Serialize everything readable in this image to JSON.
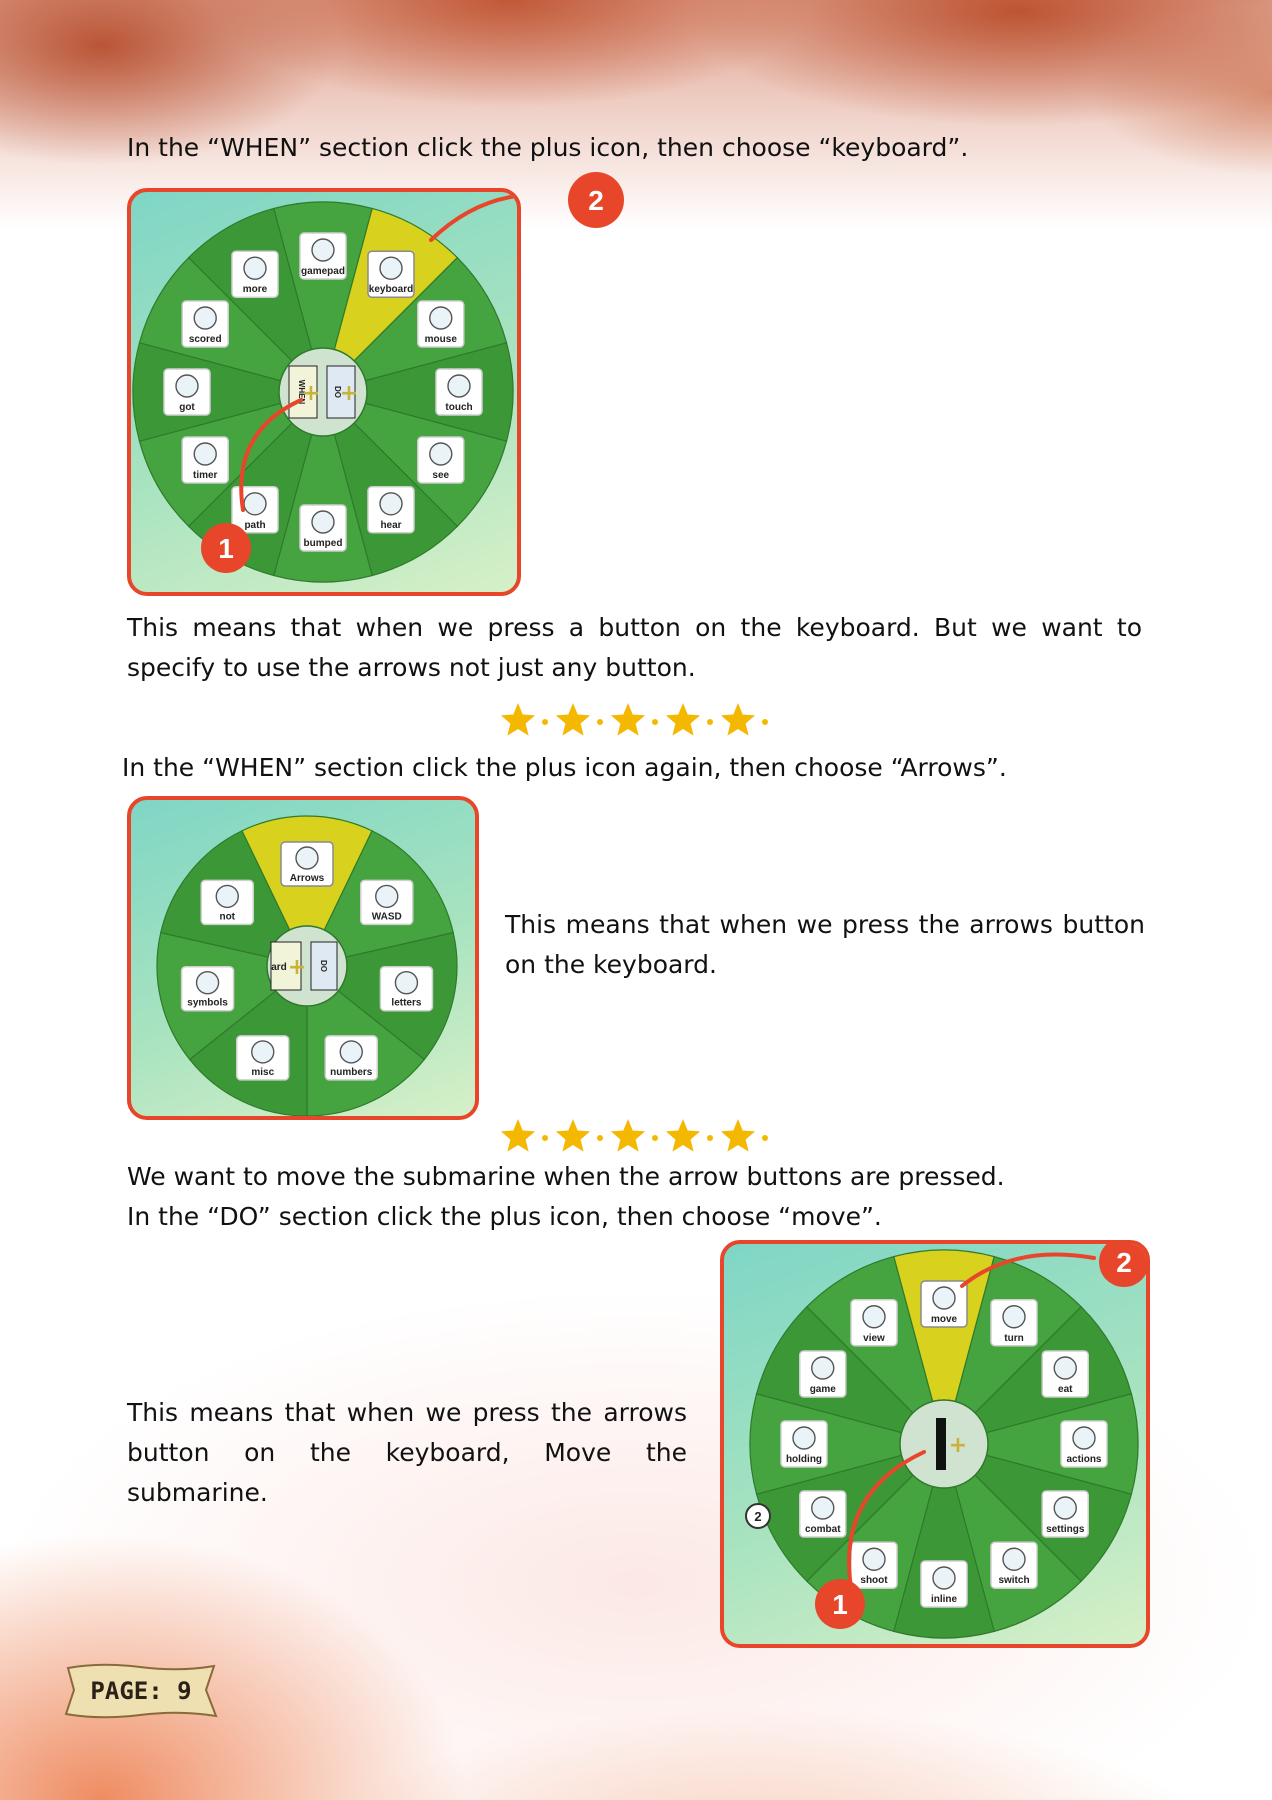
{
  "sections": {
    "s1_instruction": "In the “WHEN” section click the plus icon, then choose “keyboard”.",
    "s1_explanation": "This means that when we press a button on the keyboard. But we want to specify to use the arrows not just any button.",
    "s2_instruction": "In the “WHEN” section click the plus icon again, then choose “Arrows”.",
    "s2_explanation": "This means that when we press the arrows button on the keyboard.",
    "s3_intro_line1": "We want to move the submarine when the arrow buttons are pressed.",
    "s3_instruction": "In the “DO” section click the plus icon, then choose “move”.",
    "s3_explanation": "This means that when we press the arrows button on the keyboard, Move the submarine."
  },
  "wheel1": {
    "items": [
      "more",
      "gamepad",
      "keyboard",
      "mouse",
      "touch",
      "see",
      "hear",
      "bumped",
      "path",
      "timer",
      "got",
      "scored"
    ],
    "highlighted": "keyboard",
    "center_when": "WHEN",
    "center_do": "DO",
    "markers": [
      "1",
      "2"
    ]
  },
  "wheel2": {
    "items": [
      "Arrows",
      "WASD",
      "letters",
      "numbers",
      "misc",
      "symbols",
      "not"
    ],
    "highlighted": "Arrows",
    "center_partial": "ard",
    "center_do": "DO"
  },
  "wheel3": {
    "items": [
      "move",
      "turn",
      "eat",
      "actions",
      "settings",
      "switch",
      "inline",
      "shoot",
      "combat",
      "holding",
      "game",
      "view"
    ],
    "highlighted": "move",
    "side_badge": "2",
    "markers": [
      "1",
      "2"
    ]
  },
  "page_label": "PAGE: 9",
  "colors": {
    "marker_red": "#e8462a",
    "wheel_green": "#3e9b3a",
    "highlight_yellow": "#d8d21e",
    "star_yellow": "#f5b800"
  }
}
